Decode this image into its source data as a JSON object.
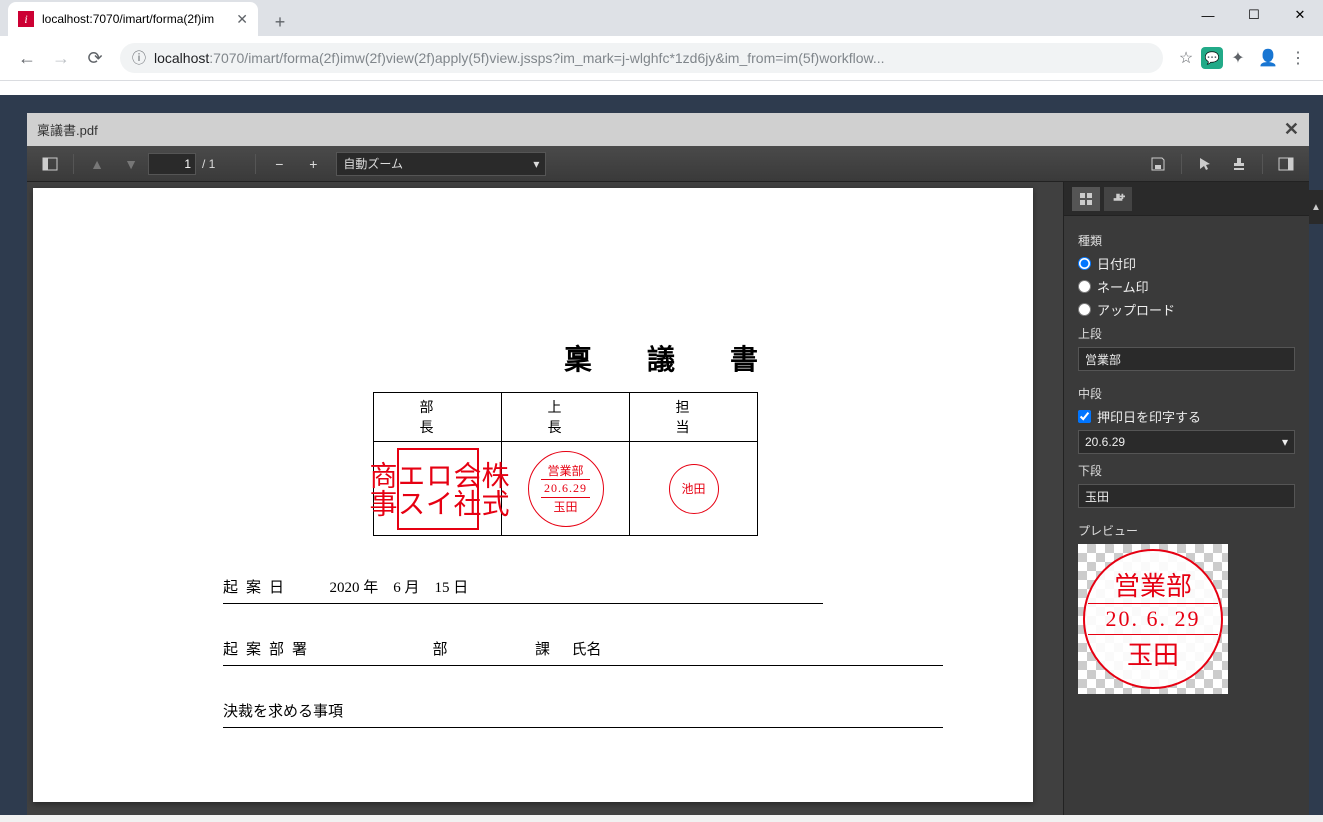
{
  "browser": {
    "tab_title": "localhost:7070/imart/forma(2f)im",
    "url_host": "localhost",
    "url_port_path": ":7070/imart/forma(2f)imw(2f)view(2f)apply(5f)view.jssps?im_mark=j-wlghfc*1zd6jy&im_from=im(5f)workflow..."
  },
  "viewer": {
    "filename": "稟議書.pdf",
    "current_page": "1",
    "total_pages": "/ 1",
    "zoom_label": "自動ズーム"
  },
  "document": {
    "title": "稟 議 書",
    "headers": {
      "col1": "部 長",
      "col2": "上 長",
      "col3": "担 当"
    },
    "stamps": {
      "square_text": "株式会社ロイエス商事",
      "date_stamp": {
        "top": "営業部",
        "mid": "20.6.29",
        "bot": "玉田"
      },
      "name_stamp": "池田"
    },
    "rows": {
      "draft_date_label": "起案日",
      "draft_date_value": "2020 年　6 月　15 日",
      "dept_label": "起案部署",
      "dept_bu": "部",
      "dept_ka": "課",
      "name_label": "氏名",
      "decision_label": "決裁を求める事項"
    }
  },
  "sidebar": {
    "type_label": "種類",
    "radio_date": "日付印",
    "radio_name": "ネーム印",
    "radio_upload": "アップロード",
    "upper_label": "上段",
    "upper_value": "営業部",
    "middle_label": "中段",
    "check_print_date": "押印日を印字する",
    "middle_value": "20.6.29",
    "lower_label": "下段",
    "lower_value": "玉田",
    "preview_label": "プレビュー",
    "preview": {
      "top": "営業部",
      "mid": "20. 6. 29",
      "bot": "玉田"
    }
  }
}
